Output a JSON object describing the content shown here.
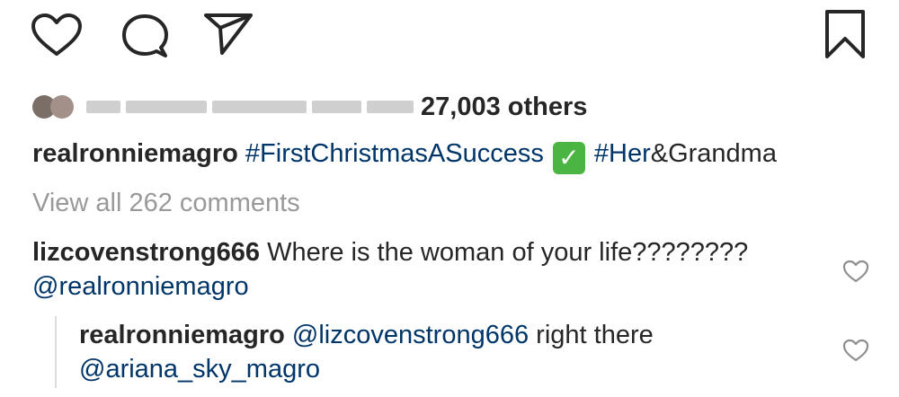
{
  "actions": {
    "like_icon": "heart-icon",
    "comment_icon": "comment-icon",
    "share_icon": "send-icon",
    "save_icon": "bookmark-icon"
  },
  "likes": {
    "others_text": "27,003 others"
  },
  "caption": {
    "username": "realronniemagro",
    "hashtag_1": "#FirstChristmasASuccess",
    "emoji": "✓",
    "hashtag_2": "#Her",
    "rest": "&Grandma"
  },
  "view_all": "View all 262 comments",
  "comments": [
    {
      "username": "lizcovenstrong666",
      "text": " Where is the woman of your life???????? ",
      "mention": "@realronniemagro"
    },
    {
      "username": "realronniemagro",
      "mention_1": "@lizcovenstrong666",
      "text": " right there ",
      "mention_2": "@ariana_sky_magro"
    }
  ],
  "colors": {
    "text": "#262626",
    "link": "#003569",
    "muted": "#999999",
    "check_bg": "#4bb543"
  }
}
